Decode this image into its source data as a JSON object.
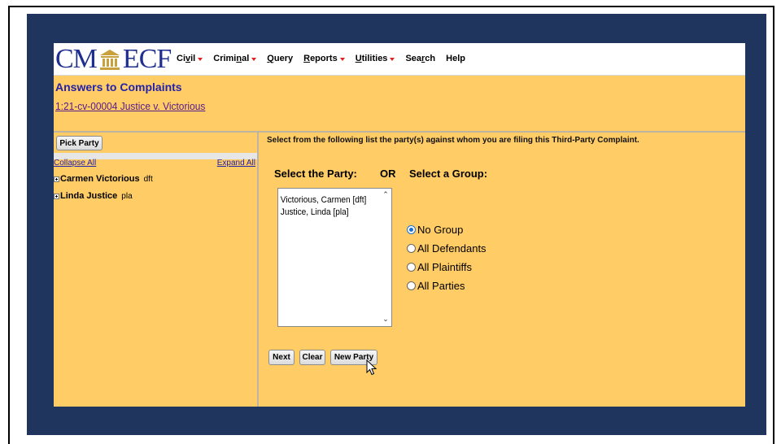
{
  "logo": {
    "left_text": "CM",
    "right_text": "ECF",
    "seal_icon": "courthouse-icon"
  },
  "menu": [
    {
      "label": "Civil",
      "underline_char": "v",
      "dropdown": true
    },
    {
      "label": "Criminal",
      "underline_char": "n",
      "dropdown": true
    },
    {
      "label": "Query",
      "underline_char": "Q",
      "dropdown": false
    },
    {
      "label": "Reports",
      "underline_char": "R",
      "dropdown": true
    },
    {
      "label": "Utilities",
      "underline_char": "U",
      "dropdown": true
    },
    {
      "label": "Search",
      "underline_char": "r",
      "dropdown": false
    },
    {
      "label": "Help",
      "underline_char": "",
      "dropdown": false
    }
  ],
  "page": {
    "title": "Answers to Complaints",
    "case_link": "1:21-cv-00004 Justice v. Victorious"
  },
  "left_panel": {
    "pick_party_button": "Pick Party",
    "collapse_all": "Collapse All",
    "expand_all": "Expand All",
    "parties": [
      {
        "name": "Carmen Victorious",
        "role": "dft"
      },
      {
        "name": "Linda Justice",
        "role": "pla"
      }
    ]
  },
  "right_panel": {
    "instruction_pre": "Select from the following list the party(s) ",
    "instruction_emph": "against",
    "instruction_post": " whom you are filing this Third-Party Complaint.",
    "select_party_label": "Select the Party:",
    "or_label": "OR",
    "select_group_label": "Select a Group:",
    "party_options": [
      "Victorious, Carmen [dft]",
      "Justice, Linda [pla]"
    ],
    "groups": [
      {
        "label": "No Group",
        "selected": true
      },
      {
        "label": "All Defendants",
        "selected": false
      },
      {
        "label": "All Plaintiffs",
        "selected": false
      },
      {
        "label": "All Parties",
        "selected": false
      }
    ],
    "buttons": {
      "next": "Next",
      "clear": "Clear",
      "new_party": "New Party"
    }
  },
  "colors": {
    "navy": "#1f355e",
    "panel": "#ffcc66",
    "link": "#2222aa",
    "radio_accent": "#1a6fd0"
  }
}
